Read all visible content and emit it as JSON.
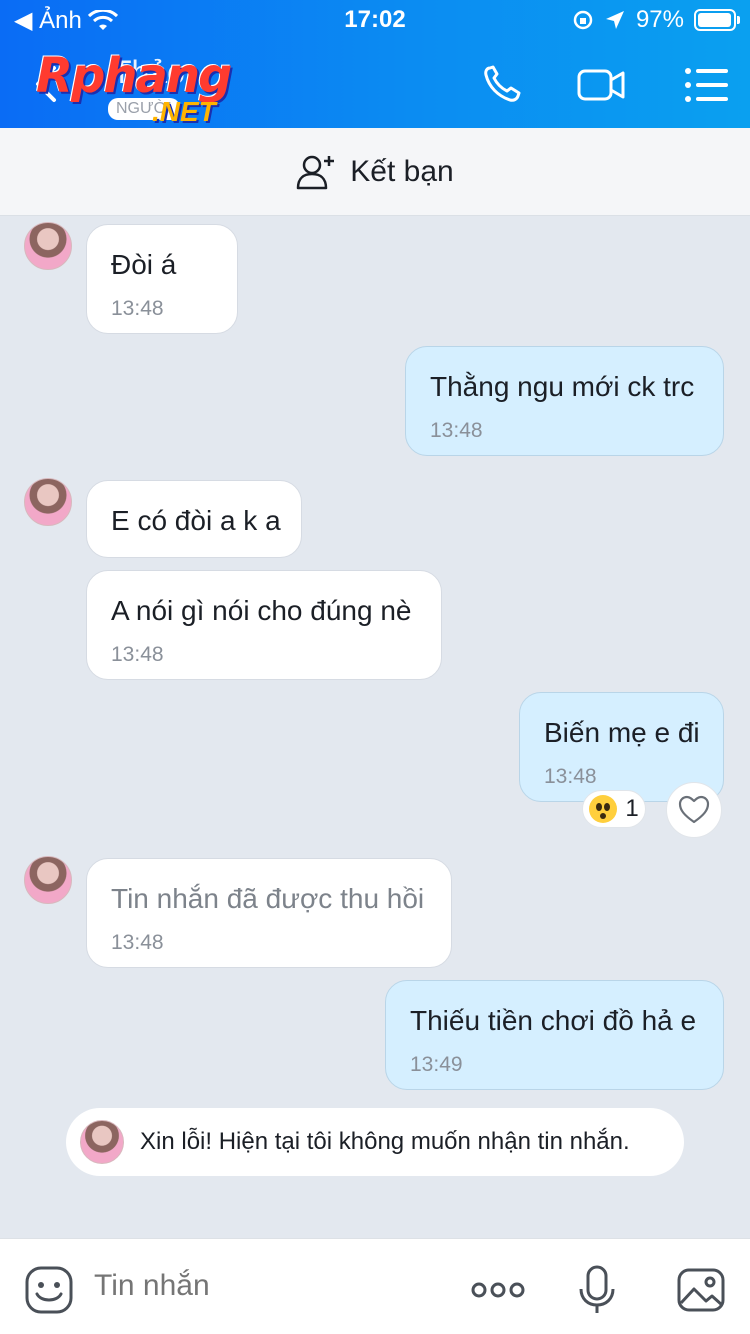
{
  "status_bar": {
    "back_app": "◀ Ảnh",
    "time": "17:02",
    "battery": "97%"
  },
  "header": {
    "contact_name": "Thảo",
    "watermark": {
      "brand": "Rphang",
      "badge": "NGƯỜI",
      "suffix": ".NET"
    },
    "icons": [
      "back-icon",
      "phone-icon",
      "video-call-icon",
      "menu-icon"
    ]
  },
  "add_friend": {
    "label": "Kết bạn",
    "icon": "add-user-icon"
  },
  "messages": [
    {
      "side": "in",
      "text": "Đòi á",
      "time": "13:48"
    },
    {
      "side": "out",
      "text": "Thằng ngu mới ck trc",
      "time": "13:48"
    },
    {
      "side": "in",
      "text": "E có đòi a k a",
      "time": ""
    },
    {
      "side": "in",
      "text": "A nói gì nói cho đúng nè",
      "time": "13:48"
    },
    {
      "side": "out",
      "text": "Biến mẹ e đi",
      "time": "13:48",
      "reaction": {
        "emoji": "shocked-face",
        "count": "1"
      }
    },
    {
      "side": "in",
      "text": "Tin nhắn đã được thu hồi",
      "time": "13:48",
      "recalled": true
    },
    {
      "side": "out",
      "text": "Thiếu tiền chơi đồ hả e",
      "time": "13:49"
    }
  ],
  "notice": {
    "text": "Xin lỗi! Hiện tại tôi không muốn nhận tin nhắn."
  },
  "input_bar": {
    "placeholder": "Tin nhắn",
    "icons": [
      "emoji-icon",
      "more-icon",
      "microphone-icon",
      "image-icon"
    ]
  },
  "colors": {
    "header": "#0b8cf2",
    "outgoing_bubble": "#d5efff",
    "incoming_bubble": "#ffffff",
    "chat_bg": "#e3e8ef"
  }
}
